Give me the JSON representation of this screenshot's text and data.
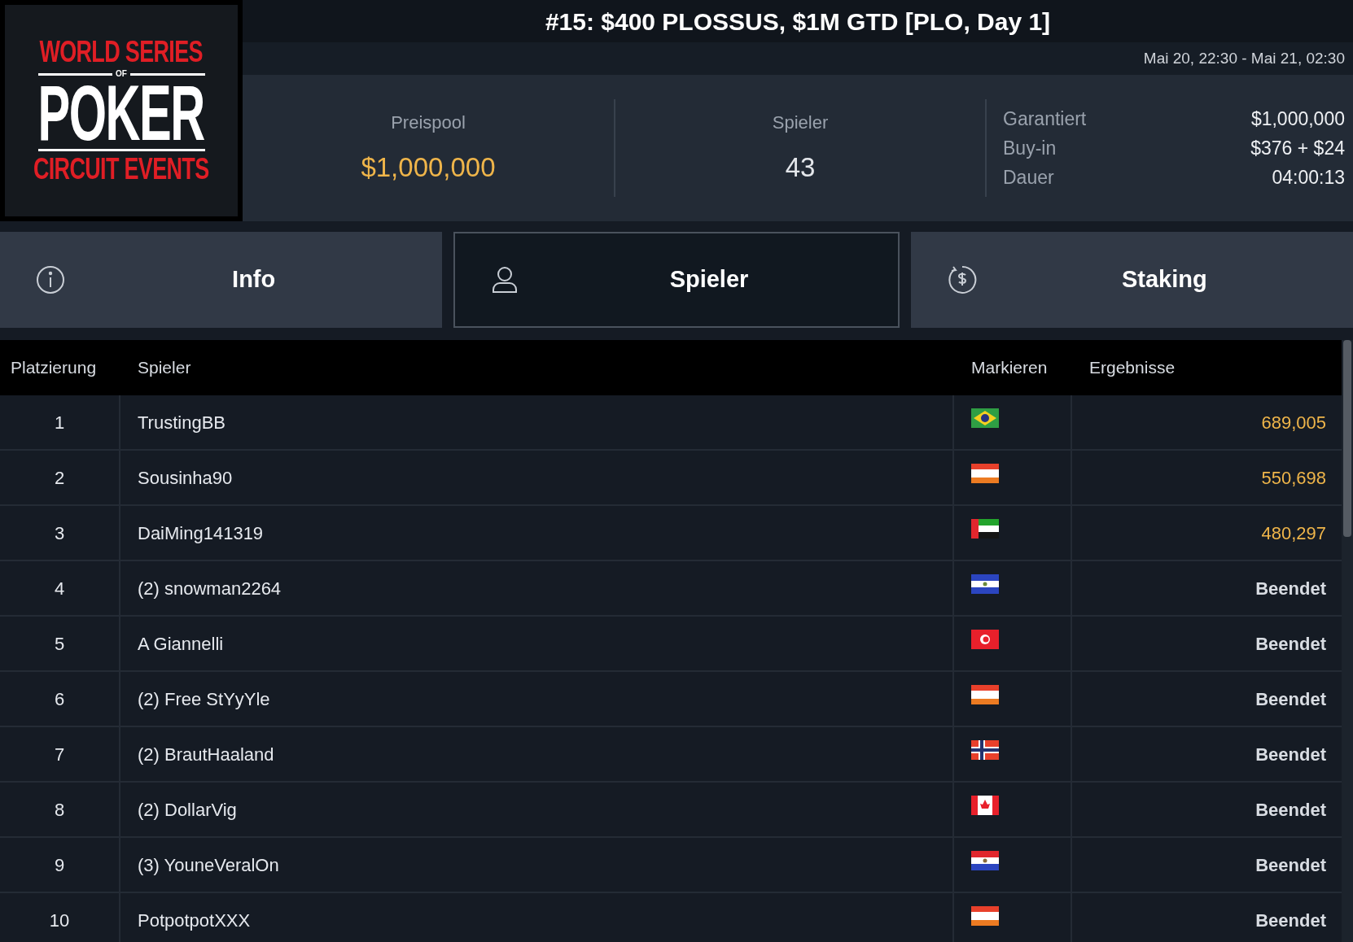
{
  "logo": {
    "line_1": "WORLD SERIES",
    "line_2": "OF",
    "line_3": "POKER",
    "line_4": "CIRCUIT EVENTS"
  },
  "title": "#15: $400 PLOSSUS, $1M GTD [PLO, Day 1]",
  "schedule": "Mai 20, 22:30 - Mai 21, 02:30",
  "stats": [
    {
      "label": "Preispool",
      "value": "$1,000,000",
      "highlight": true
    },
    {
      "label": "Spieler",
      "value": "43",
      "highlight": false
    }
  ],
  "details": [
    {
      "label": "Garantiert",
      "value": "$1,000,000"
    },
    {
      "label": "Buy-in",
      "value": "$376 + $24"
    },
    {
      "label": "Dauer",
      "value": "04:00:13"
    }
  ],
  "tabs": [
    {
      "label": "Info",
      "selected": false
    },
    {
      "label": "Spieler",
      "selected": true
    },
    {
      "label": "Staking",
      "selected": false
    }
  ],
  "table": {
    "columns": [
      "Platzierung",
      "Spieler",
      "Markieren",
      "Ergebnisse"
    ],
    "rows": [
      {
        "place": "1",
        "player": "TrustingBB",
        "kind": "brazil",
        "result": "689,005",
        "in_money": true
      },
      {
        "place": "2",
        "player": "Sousinha90",
        "kind": "austria",
        "result": "550,698",
        "in_money": true
      },
      {
        "place": "3",
        "player": "DaiMing141319",
        "kind": "uae",
        "result": "480,297",
        "in_money": true
      },
      {
        "place": "4",
        "player": "(2) snowman2264",
        "kind": "el_salvador",
        "result": "Beendet",
        "in_money": false
      },
      {
        "place": "5",
        "player": "A Giannelli",
        "kind": "tunisia",
        "result": "Beendet",
        "in_money": false
      },
      {
        "place": "6",
        "player": "(2) Free StYyYle",
        "kind": "austria",
        "result": "Beendet",
        "in_money": false
      },
      {
        "place": "7",
        "player": "(2) BrautHaaland",
        "kind": "norway",
        "result": "Beendet",
        "in_money": false
      },
      {
        "place": "8",
        "player": "(2) DollarVig",
        "kind": "canada",
        "result": "Beendet",
        "in_money": false
      },
      {
        "place": "9",
        "player": "(3) YouneVeralOn",
        "kind": "paraguay",
        "result": "Beendet",
        "in_money": false
      },
      {
        "place": "10",
        "player": "PotpotpotXXX",
        "kind": "austria",
        "result": "Beendet",
        "in_money": false
      }
    ]
  }
}
